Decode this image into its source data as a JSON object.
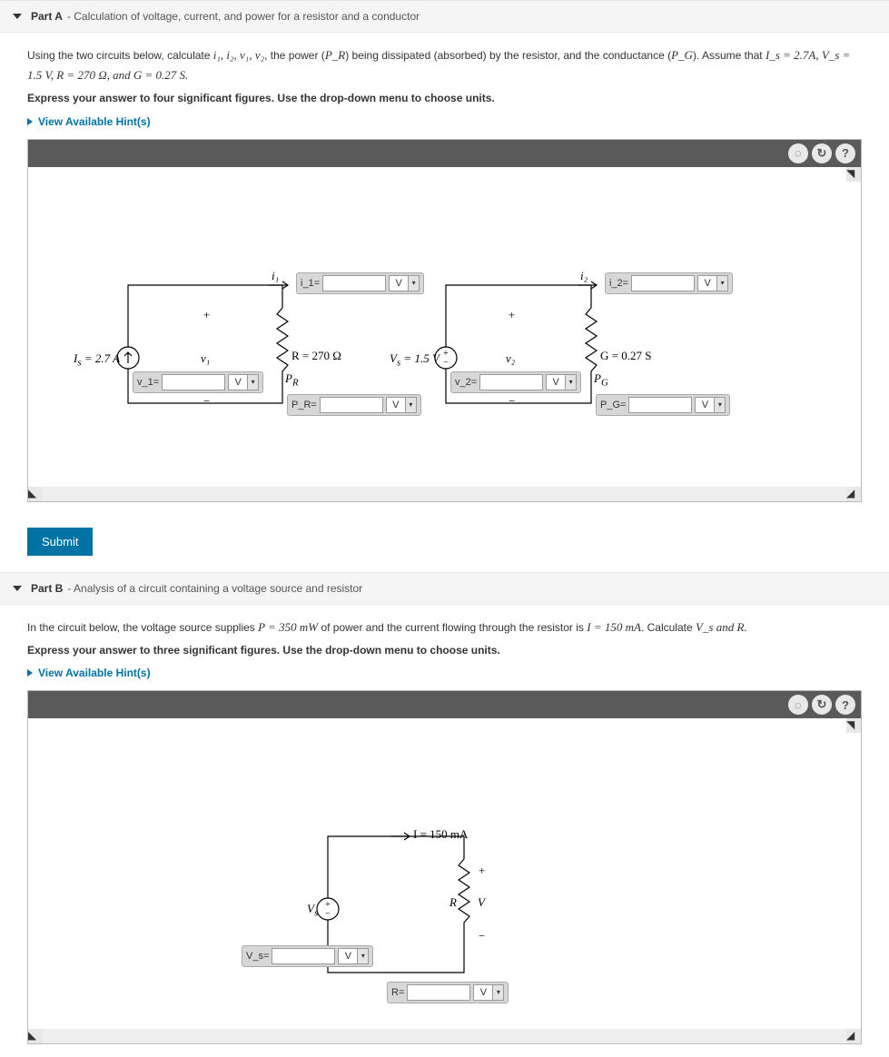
{
  "partA": {
    "title": "Part A",
    "desc": " - Calculation of voltage, current, and power for a resistor and a conductor",
    "prompt_prefix": "Using the two circuits below, calculate ",
    "prompt_vars": "i₁, i₂, v₁, v₂",
    "prompt_mid1": ", the power (",
    "PR": "P_R",
    "prompt_mid2": ") being dissipated (absorbed) by the resistor, and the conductance (",
    "PG": "P_G",
    "prompt_mid3": "). Assume that ",
    "assume": "I_s = 2.7A, V_s = 1.5 V, R = 270 Ω, and G = 0.27 S.",
    "instr": "Express your answer to four significant figures. Use the drop-down menu to choose units.",
    "hints": "View Available Hint(s)",
    "circuit1": {
      "Is_label": "I_s = 2.7 A",
      "i1": "i₁",
      "v1": "v₁",
      "R_label": "R = 270 Ω",
      "PR": "P_R",
      "fields": {
        "i1": "i_1=",
        "v1": "v_1=",
        "PR": "P_R="
      }
    },
    "circuit2": {
      "Vs_label": "V_s = 1.5 V",
      "i2": "i₂",
      "v2": "v₂",
      "G_label": "G  = 0.27 S",
      "PG": "P_G",
      "fields": {
        "i2": "i_2=",
        "v2": "v_2=",
        "PG": "P_G="
      }
    },
    "unit_default": "V",
    "submit": "Submit"
  },
  "partB": {
    "title": "Part B",
    "desc": " - Analysis of a circuit containing a voltage source and resistor",
    "prompt_prefix": "In the circuit below, the voltage source supplies ",
    "P": "P = 350 mW",
    "prompt_mid1": " of power and the current flowing through the resistor is ",
    "I": "I = 150 mA",
    "prompt_mid2": ". Calculate ",
    "calc": "V_s and R.",
    "instr": "Express your answer to three significant figures. Use the drop-down menu to choose units.",
    "hints": "View Available Hint(s)",
    "circuit": {
      "I_label": "I  = 150 mA",
      "Vs": "V_s",
      "R": "R",
      "V": "V",
      "fields": {
        "Vs": "V_s=",
        "R": "R="
      }
    }
  }
}
